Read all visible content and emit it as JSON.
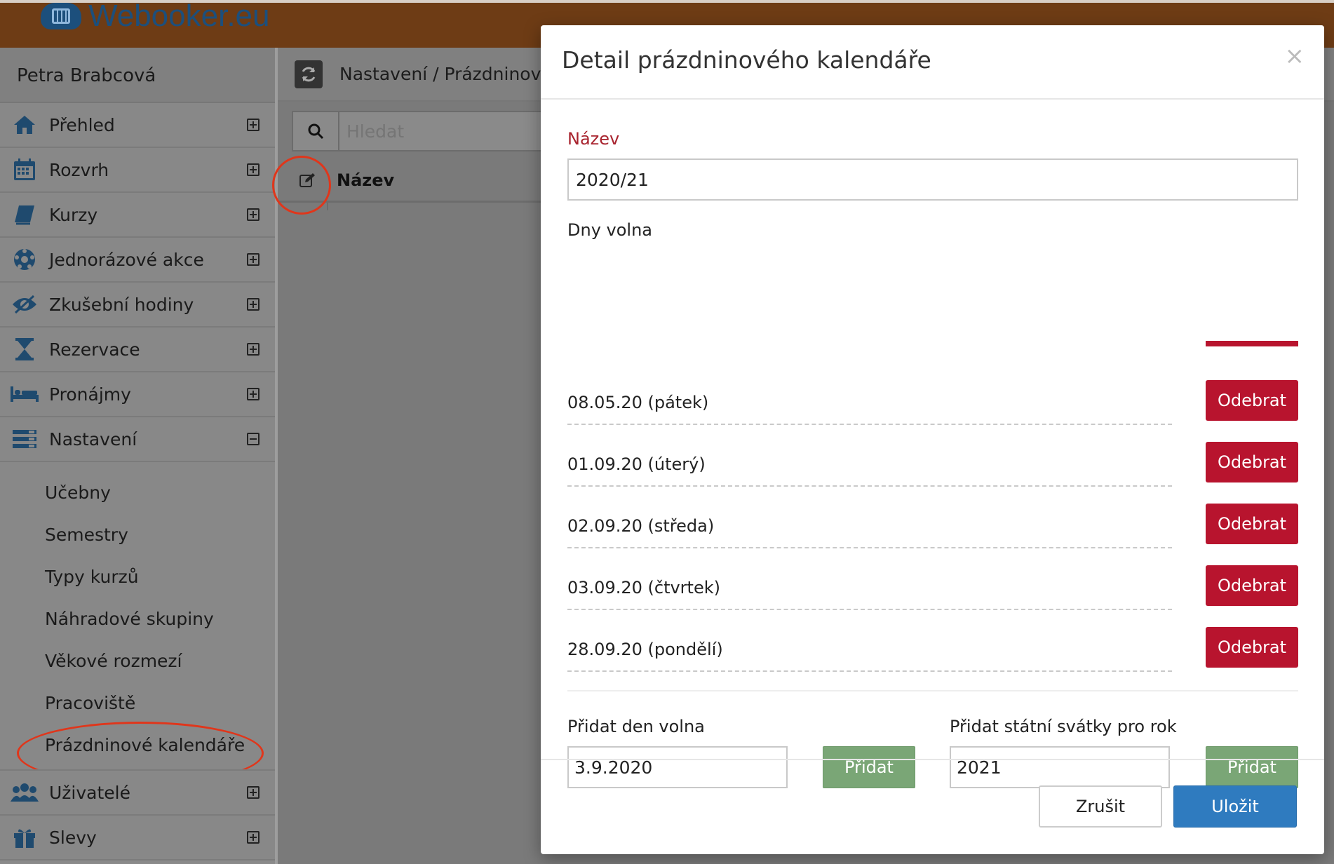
{
  "brand": {
    "name": "Webooker.eu"
  },
  "sidebar": {
    "user_name": "Petra Brabcová",
    "items": [
      {
        "label": "Přehled",
        "icon": "home-icon"
      },
      {
        "label": "Rozvrh",
        "icon": "calendar-icon"
      },
      {
        "label": "Kurzy",
        "icon": "book-icon"
      },
      {
        "label": "Jednorázové akce",
        "icon": "soccer-ball-icon"
      },
      {
        "label": "Zkušební hodiny",
        "icon": "eye-icon"
      },
      {
        "label": "Rezervace",
        "icon": "hourglass-icon"
      },
      {
        "label": "Pronájmy",
        "icon": "bed-icon"
      },
      {
        "label": "Nastavení",
        "icon": "settings-list-icon"
      }
    ],
    "settings_submenu": [
      "Učebny",
      "Semestry",
      "Typy kurzů",
      "Náhradové skupiny",
      "Věkové rozmezí",
      "Pracoviště",
      "Prázdninové kalendáře"
    ],
    "items_after": [
      {
        "label": "Uživatelé",
        "icon": "users-icon"
      },
      {
        "label": "Slevy",
        "icon": "gift-icon"
      }
    ]
  },
  "main": {
    "breadcrumb": "Nastavení / Prázdninové k",
    "search_placeholder": "Hledat",
    "table_header_name": "Název"
  },
  "modal": {
    "title": "Detail prázdninového kalendáře",
    "close_glyph": "×",
    "name_label": "Název",
    "name_value": "2020/21",
    "days_label": "Dny volna",
    "remove_label": "Odebrat",
    "days": [
      "08.05.20 (pátek)",
      "01.09.20 (úterý)",
      "02.09.20 (středa)",
      "03.09.20 (čtvrtek)",
      "28.09.20 (pondělí)"
    ],
    "add_day_label": "Přidat den volna",
    "add_day_value": "3.9.2020",
    "add_holidays_label": "Přidat státní svátky pro rok",
    "add_holidays_value": "2021",
    "add_button": "Přidat",
    "cancel_button": "Zrušit",
    "save_button": "Uložit"
  },
  "colors": {
    "brand_bar": "#6e3c15",
    "danger": "#b8142e",
    "success": "#7aa676",
    "primary": "#2f7bbf",
    "label_red": "#a8232e",
    "annotation": "#e0361b"
  }
}
